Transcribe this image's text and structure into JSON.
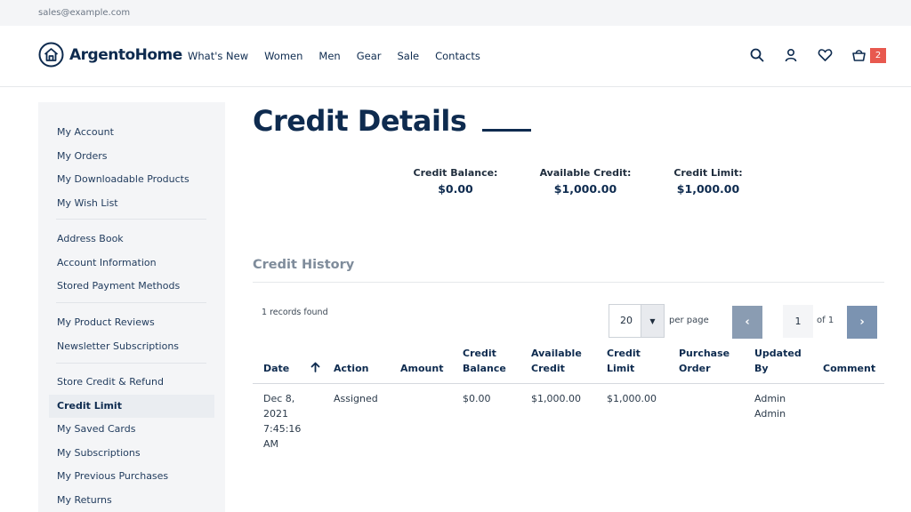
{
  "topbar": {
    "email": "sales@example.com"
  },
  "brand": {
    "name": "ArgentoHome"
  },
  "nav": [
    "What's New",
    "Women",
    "Men",
    "Gear",
    "Sale",
    "Contacts"
  ],
  "cart": {
    "count": "2"
  },
  "icons": [
    "search-icon",
    "user-icon",
    "heart-icon",
    "cart-icon"
  ],
  "sidebar": {
    "group1": [
      "My Account",
      "My Orders",
      "My Downloadable Products",
      "My Wish List"
    ],
    "group2": [
      "Address Book",
      "Account Information",
      "Stored Payment Methods"
    ],
    "group3": [
      "My Product Reviews",
      "Newsletter Subscriptions"
    ],
    "group4": [
      "Store Credit & Refund",
      "Credit Limit",
      "My Saved Cards",
      "My Subscriptions",
      "My Previous Purchases",
      "My Returns"
    ],
    "active": "Credit Limit"
  },
  "page": {
    "title": "Credit Details"
  },
  "summary": [
    {
      "label": "Credit Balance:",
      "value": "$0.00"
    },
    {
      "label": "Available Credit:",
      "value": "$1,000.00"
    },
    {
      "label": "Credit Limit:",
      "value": "$1,000.00"
    }
  ],
  "history": {
    "title": "Credit History",
    "records": "1 records found",
    "per_page_value": "20",
    "per_page_label": "per page",
    "current_page": "1",
    "of_label": "of 1",
    "columns": {
      "date": "Date",
      "action": "Action",
      "amount": "Amount",
      "credit_balance": [
        "Credit",
        "Balance"
      ],
      "available_credit": [
        "Available",
        "Credit"
      ],
      "credit_limit": [
        "Credit",
        "Limit"
      ],
      "purchase_order": [
        "Purchase",
        "Order"
      ],
      "updated_by": [
        "Updated",
        "By"
      ],
      "comment": "Comment"
    },
    "rows": [
      {
        "date": [
          "Dec 8,",
          "2021",
          "7:45:16",
          "AM"
        ],
        "action": "Assigned",
        "amount": "",
        "credit_balance": "$0.00",
        "available_credit": "$1,000.00",
        "credit_limit": "$1,000.00",
        "purchase_order": "",
        "updated_by": [
          "Admin",
          "Admin"
        ],
        "comment": ""
      }
    ]
  },
  "colors": {
    "brand": "#0e2b4f",
    "badge": "#e8594f",
    "pager": "#8a9cb2"
  }
}
